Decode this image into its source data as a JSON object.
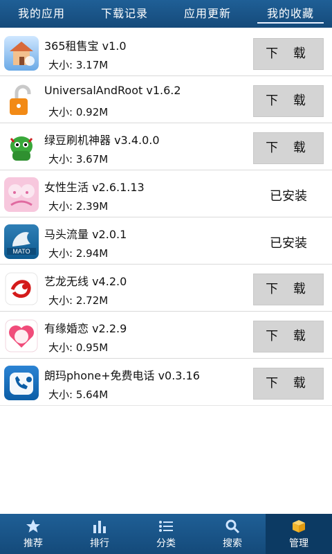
{
  "top_tabs": [
    "我的应用",
    "下载记录",
    "应用更新",
    "我的收藏"
  ],
  "active_top_tab": 3,
  "apps": [
    {
      "title": "365租售宝 v1.0",
      "size_label": "大小:",
      "size": "3.17M",
      "action": "download",
      "action_label": "下 载",
      "icon": "house-icon"
    },
    {
      "title": "UniversalAndRoot v1.6.2",
      "size_label": "大小:",
      "size": "0.92M",
      "action": "download",
      "action_label": "下 载",
      "icon": "lock-icon"
    },
    {
      "title": "绿豆刷机神器 v3.4.0.0",
      "size_label": "大小:",
      "size": "3.67M",
      "action": "download",
      "action_label": "下 载",
      "icon": "android-icon"
    },
    {
      "title": "女性生活 v2.6.1.13",
      "size_label": "大小:",
      "size": "2.39M",
      "action": "installed",
      "action_label": "已安装",
      "icon": "female-icon"
    },
    {
      "title": "马头流量 v2.0.1",
      "size_label": "大小:",
      "size": "2.94M",
      "action": "installed",
      "action_label": "已安装",
      "icon": "mato-icon"
    },
    {
      "title": "艺龙无线 v4.2.0",
      "size_label": "大小:",
      "size": "2.72M",
      "action": "download",
      "action_label": "下 载",
      "icon": "elong-icon"
    },
    {
      "title": "有缘婚恋 v2.2.9",
      "size_label": "大小:",
      "size": "0.95M",
      "action": "download",
      "action_label": "下 载",
      "icon": "love-icon"
    },
    {
      "title": "朗玛phone+免费电话 v0.3.16",
      "size_label": "大小:",
      "size": "5.64M",
      "action": "download",
      "action_label": "下 载",
      "icon": "phone-icon"
    }
  ],
  "bottom_nav": [
    {
      "label": "推荐",
      "icon": "star-icon"
    },
    {
      "label": "排行",
      "icon": "bar-chart-icon"
    },
    {
      "label": "分类",
      "icon": "list-icon"
    },
    {
      "label": "搜索",
      "icon": "search-icon"
    },
    {
      "label": "管理",
      "icon": "box-icon"
    }
  ],
  "active_bottom_nav": 4,
  "colors": {
    "bar": "#1a568c",
    "button_bg": "#d4d4d4"
  }
}
